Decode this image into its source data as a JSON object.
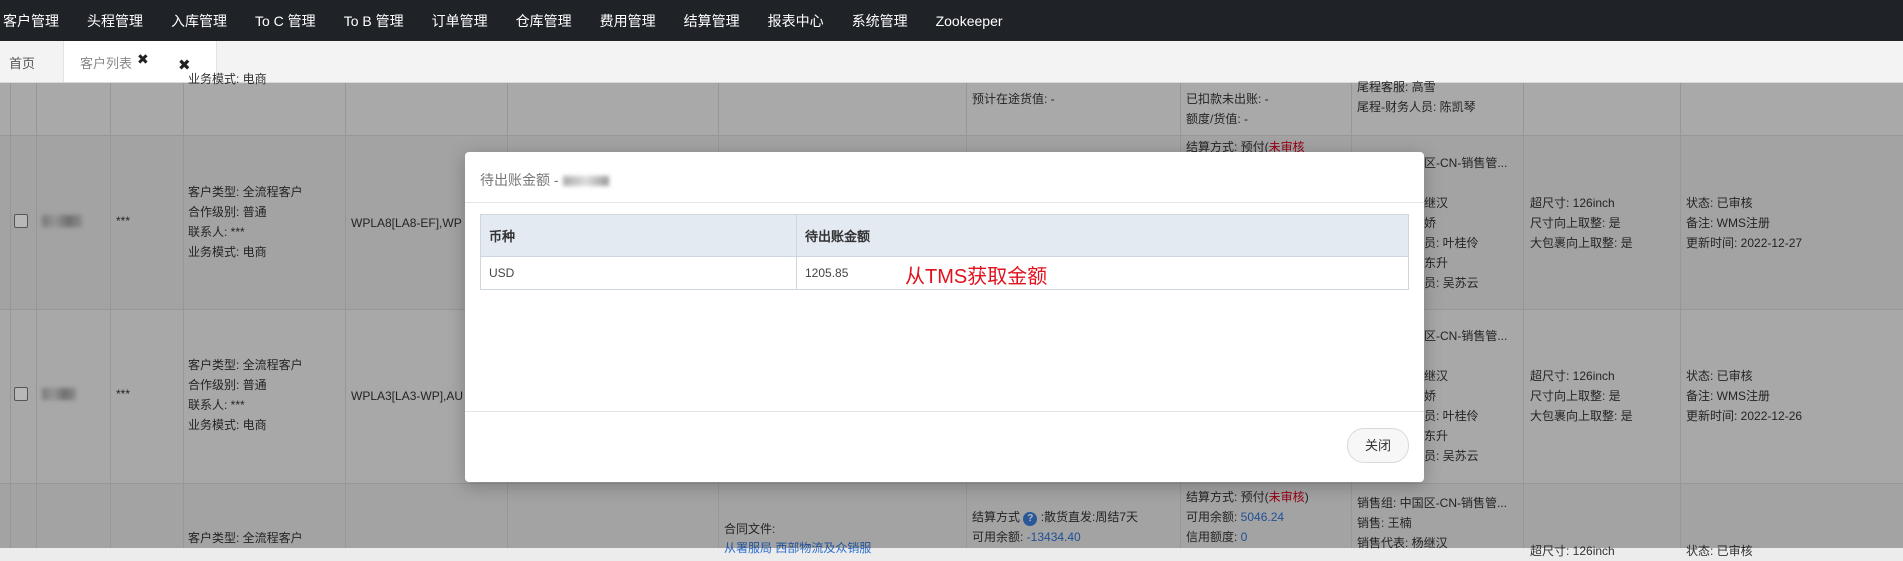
{
  "topnav": [
    "客户管理",
    "头程管理",
    "入库管理",
    "To C 管理",
    "To B 管理",
    "订单管理",
    "仓库管理",
    "费用管理",
    "结算管理",
    "报表中心",
    "系统管理",
    "Zookeeper"
  ],
  "tabs": {
    "home": "首页",
    "customers": "客户列表",
    "close_tab": "✖",
    "close_all": "✖"
  },
  "bg_rows": {
    "row0": {
      "c1_l1": "业务模式: 电商",
      "c6_l1": "预计在途货值: -",
      "c7_l1": "已扣款未出账: -",
      "c7_l2": "额度/货值: -",
      "c8_l1": "尾程客服: 高雪",
      "c8_l2": "尾程-财务人员: 陈凯琴"
    },
    "row1": {
      "masked": "***",
      "c1": [
        "客户类型: 全流程客户",
        "合作级别: 普通",
        "联系人: ***",
        "业务模式: 电商"
      ],
      "wpl": "WPLA8[LA8-EF],WP",
      "c7_top": "结算方式: 预付(",
      "c7_top_red": "未审核",
      "c8": [
        "区-CN-销售管...",
        "继汉",
        "娇",
        "员: 叶桂伶",
        "东升",
        "员: 吴苏云"
      ],
      "c9": [
        "超尺寸: 126inch",
        "尺寸向上取整: 是",
        "大包裹向上取整: 是"
      ],
      "c10": [
        "状态: 已审核",
        "备注: WMS注册",
        "更新时间: 2022-12-27"
      ]
    },
    "row2": {
      "masked": "***",
      "c1": [
        "客户类型: 全流程客户",
        "合作级别: 普通",
        "联系人: ***",
        "业务模式: 电商"
      ],
      "wpl": "WPLA3[LA3-WP],AU",
      "c8": [
        "区-CN-销售管...",
        "继汉",
        "娇",
        "员: 叶桂伶",
        "东升",
        "员: 吴苏云"
      ],
      "c9": [
        "超尺寸: 126inch",
        "尺寸向上取整: 是",
        "大包裹向上取整: 是"
      ],
      "c10": [
        "状态: 已审核",
        "备注: WMS注册",
        "更新时间: 2022-12-26"
      ]
    },
    "row3": {
      "c1_l1": "客户类型: 全流程客户",
      "c5_l1": "合同文件:",
      "c5_l2": "从署服局 西部物流及众销服",
      "c6_l1": "结算方式",
      "c6_l1b": ":散货直发:周结7天",
      "c6_l2": "可用余额: ",
      "c6_l2v": "-13434.40",
      "c7_l1": "结算方式: 预付(",
      "c7_l1r": "未审核",
      "c7_l1e": ")",
      "c7_l2": "可用余额: ",
      "c7_l2v": "5046.24",
      "c7_l3": "信用额度: ",
      "c7_l3v": "0",
      "c8_l1": "销售组: 中国区-CN-销售管...",
      "c8_l2": "销售: 王楠",
      "c8_l3": "销售代表: 杨继汉",
      "c9_l1": "超尺寸: 126inch",
      "c10_l1": "状态: 已审核"
    }
  },
  "modal": {
    "title": "待出账金额 -",
    "columns": [
      "币种",
      "待出账金额"
    ],
    "rows": [
      [
        "USD",
        "1205.85"
      ]
    ],
    "annotation": "从TMS获取金额",
    "close_label": "关闭"
  },
  "colors": {
    "topnav_bg": "#1f2227",
    "annotation_red": "#e0101c",
    "link_blue": "#2f6fd0",
    "header_bg": "#e3eaf1"
  }
}
